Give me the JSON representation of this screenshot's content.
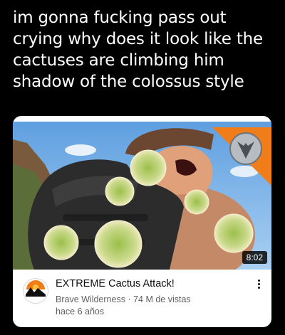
{
  "post": {
    "lines": [
      "im gonna fucking pass out",
      "crying why does it look like the",
      "cactuses are climbing him",
      "shadow of the colossus style"
    ]
  },
  "video": {
    "duration": "8:02",
    "title": "EXTREME Cactus Attack!",
    "channel": "Brave Wilderness",
    "separator": "·",
    "views": "74 M de vistas",
    "age": "hace 6 años"
  },
  "icons": {
    "thumbnail_badge": "fox-emblem-icon",
    "channel_avatar": "brave-wilderness-logo-icon",
    "menu": "more-vert-icon"
  },
  "colors": {
    "background": "#000000",
    "card": "#ffffff",
    "badge_orange": "#f07d1a",
    "sky": "#7fb6e8"
  }
}
